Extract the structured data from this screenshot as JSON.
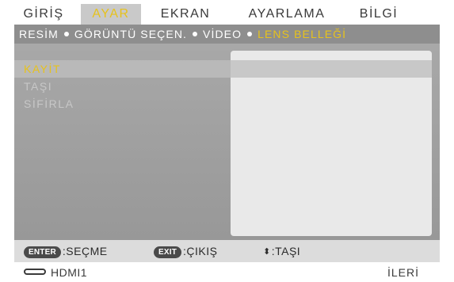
{
  "tabs": [
    {
      "label": "GİRİŞ",
      "active": false
    },
    {
      "label": "AYAR",
      "active": true
    },
    {
      "label": "EKRAN",
      "active": false
    },
    {
      "label": "AYARLAMA",
      "active": false
    },
    {
      "label": "BİLGİ",
      "active": false
    }
  ],
  "breadcrumb": [
    {
      "label": "RESİM",
      "active": false
    },
    {
      "label": "GÖRÜNTÜ SEÇEN.",
      "active": false
    },
    {
      "label": "VİDEO",
      "active": false
    },
    {
      "label": "LENS BELLEĞİ",
      "active": true
    }
  ],
  "menu": {
    "items": [
      {
        "label": "KAYİT",
        "selected": true
      },
      {
        "label": "TAŞI",
        "selected": false
      },
      {
        "label": "SİFİRLA",
        "selected": false
      }
    ]
  },
  "help": {
    "enter_key": "ENTER",
    "enter_label": ":SEÇME",
    "exit_key": "EXIT",
    "exit_label": ":ÇIKIŞ",
    "move_icon": "up-down-arrows-icon",
    "move_label": ":TAŞI"
  },
  "status": {
    "input_icon": "hdmi-connector-icon",
    "input_label": "HDMI1",
    "next_label": "İLERİ"
  },
  "colors": {
    "accent": "#e7c21c",
    "menu_bg": "#a0a0a0",
    "subbar_bg": "#8e8e8e",
    "panel_bg": "#e9e9e9",
    "help_bg": "#dcdcdc"
  }
}
